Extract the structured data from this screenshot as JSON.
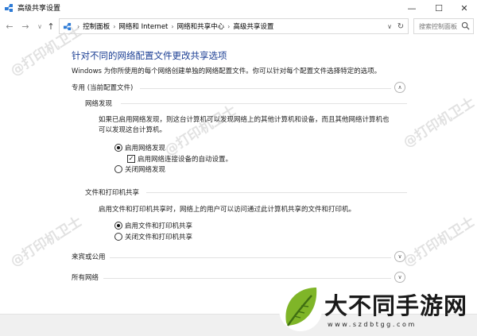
{
  "window": {
    "title": "高级共享设置",
    "minimize": "—",
    "maximize": "☐",
    "close": "✕"
  },
  "nav": {
    "back": "←",
    "forward": "→",
    "dropdown": "∨",
    "up": "↑",
    "breadcrumbs": [
      "控制面板",
      "网络和 Internet",
      "网络和共享中心",
      "高级共享设置"
    ],
    "separator": "›",
    "address_dropdown": "∨",
    "refresh": "↻",
    "search_placeholder": "搜索控制面板"
  },
  "page": {
    "heading": "针对不同的网络配置文件更改共享选项",
    "description": "Windows 为你所使用的每个网络创建单独的网络配置文件。你可以针对每个配置文件选择特定的选项。"
  },
  "profiles": {
    "private": {
      "label": "专用 (当前配置文件)",
      "toggle": "∧"
    },
    "guest": {
      "label": "来宾或公用",
      "toggle": "∨"
    },
    "all": {
      "label": "所有网络",
      "toggle": "∨"
    }
  },
  "network_discovery": {
    "heading": "网络发现",
    "text_line1": "如果已启用网络发现，则这台计算机可以发现网络上的其他计算机和设备，而且其他网络计算机也",
    "text_line2": "可以发现这台计算机。",
    "option_on": "启用网络发现",
    "auto_setup": "启用网络连接设备的自动设置。",
    "auto_setup_check": "✓",
    "option_off": "关闭网络发现"
  },
  "file_sharing": {
    "heading": "文件和打印机共享",
    "text": "启用文件和打印机共享时，网络上的用户可以访问通过此计算机共享的文件和打印机。",
    "option_on": "启用文件和打印机共享",
    "option_off": "关闭文件和打印机共享"
  },
  "watermark": "@打印机卫士",
  "brand": {
    "name": "大不同手游网",
    "url": "www.szdbtgg.com"
  },
  "colors": {
    "heading": "#1c3f94",
    "leaf": "#7fb528",
    "leaf_dark": "#3f6e12"
  }
}
